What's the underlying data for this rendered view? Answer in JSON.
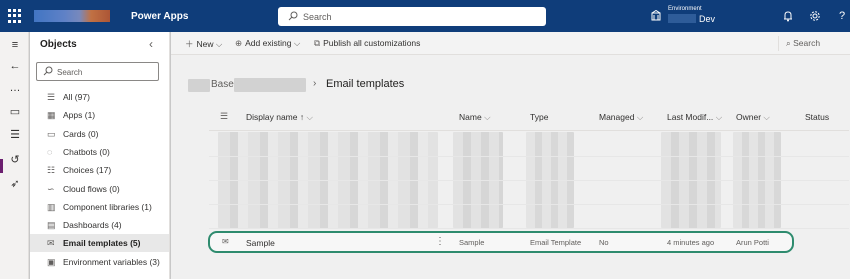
{
  "topbar": {
    "app_title": "Power Apps",
    "search_placeholder": "Search",
    "environment_label": "Environment",
    "environment_name": "Dev",
    "icons": [
      "waffle-icon",
      "environment-icon",
      "bell-icon",
      "gear-icon",
      "help-icon"
    ]
  },
  "rail": {
    "icons": [
      "hamburger-icon",
      "back-icon",
      "dots-icon",
      "book-icon",
      "tree-icon",
      "history-icon",
      "rocket-icon"
    ]
  },
  "objects": {
    "title": "Objects",
    "search_placeholder": "Search",
    "items": [
      {
        "label": "All (97)",
        "icon": "list-icon"
      },
      {
        "label": "Apps (1)",
        "icon": "apps-icon"
      },
      {
        "label": "Cards (0)",
        "icon": "card-icon"
      },
      {
        "label": "Chatbots (0)",
        "icon": "chatbot-icon"
      },
      {
        "label": "Choices (17)",
        "icon": "choice-icon"
      },
      {
        "label": "Cloud flows (0)",
        "icon": "flow-icon"
      },
      {
        "label": "Component libraries (1)",
        "icon": "library-icon"
      },
      {
        "label": "Dashboards (4)",
        "icon": "dashboard-icon"
      },
      {
        "label": "Email templates (5)",
        "icon": "email-icon",
        "selected": true
      },
      {
        "label": "Environment variables (3)",
        "icon": "variable-icon"
      }
    ]
  },
  "commands": {
    "new": "New",
    "add_existing": "Add existing",
    "publish_all": "Publish all customizations",
    "search": "Search"
  },
  "breadcrumb": {
    "parent_fragment": "Base",
    "current": "Email templates"
  },
  "table": {
    "columns": [
      "Display name ↑",
      "Name",
      "Type",
      "Managed",
      "Last Modif...",
      "Owner",
      "Status"
    ],
    "sample_row": {
      "display_name": "Sample",
      "name": "Sample",
      "type": "Email Template",
      "managed": "No",
      "last_modified": "4 minutes ago",
      "owner": "Arun Potti"
    }
  }
}
